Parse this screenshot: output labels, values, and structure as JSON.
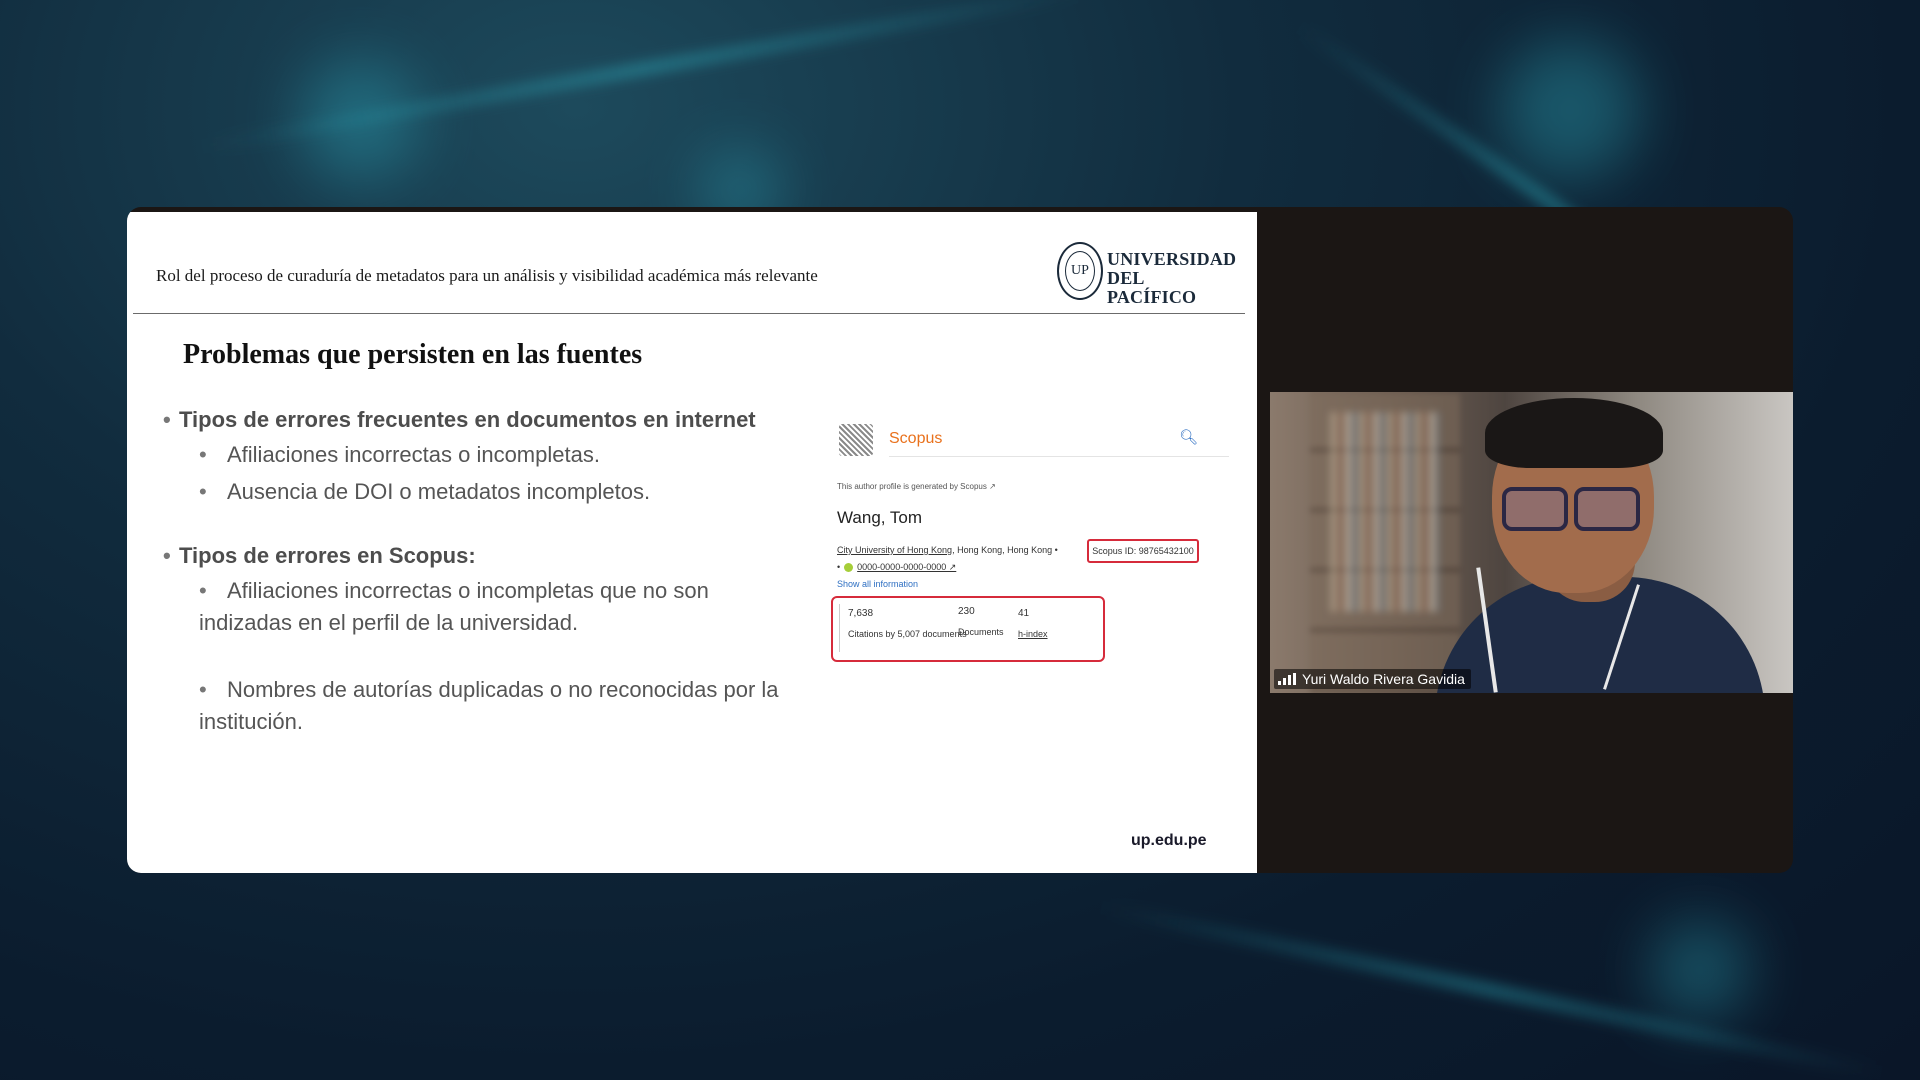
{
  "slide": {
    "header_text": "Rol del proceso de curaduría de metadatos para un análisis y visibilidad académica más relevante",
    "logo_line1": "UNIVERSIDAD",
    "logo_line2": "DEL PACÍFICO",
    "title": "Problemas que persisten en las fuentes",
    "bullets": [
      {
        "text": "Tipos de errores frecuentes en documentos en internet",
        "sub": [
          "Afiliaciones incorrectas o incompletas.",
          "Ausencia de DOI o metadatos incompletos."
        ]
      },
      {
        "text": "Tipos de errores en Scopus:",
        "sub": [
          "Afiliaciones incorrectas o incompletas que no son indizadas en el perfil de la universidad.",
          "Nombres de autorías duplicadas o no reconocidas por la institución."
        ]
      }
    ],
    "footer_url": "up.edu.pe"
  },
  "scopus": {
    "brand": "Scopus",
    "note": "This author profile is generated by Scopus ↗",
    "author": "Wang, Tom",
    "affiliation_link": "City University of Hong Kong",
    "affiliation_rest": ", Hong Kong, Hong Kong •",
    "scopus_id": "Scopus ID: 98765432100",
    "orcid": "0000-0000-0000-0000 ↗",
    "show_all": "Show all information",
    "metrics": [
      {
        "value": "7,638",
        "label": "Citations by 5,007 documents"
      },
      {
        "value": "230",
        "label": "Documents"
      },
      {
        "value": "41",
        "label": "h-index"
      }
    ]
  },
  "video": {
    "participant_name": "Yuri Waldo Rivera Gavidia"
  },
  "colors": {
    "scopus_orange": "#e9711c",
    "highlight_red": "#d62b3b",
    "link_blue": "#2e6fc2"
  }
}
